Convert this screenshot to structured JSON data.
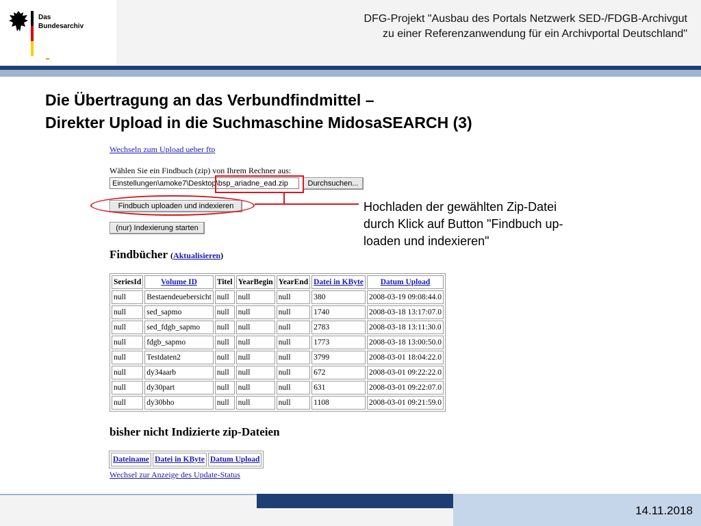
{
  "header": {
    "logo_line1": "Das",
    "logo_line2": "Bundesarchiv",
    "title_line1": "DFG-Projekt \"Ausbau des Portals Netzwerk SED-/FDGB-Archivgut",
    "title_line2": "zu einer Referenzanwendung für ein Archivportal Deutschland\""
  },
  "slide": {
    "title_line1": "Die Übertragung an das Verbundfindmittel –",
    "title_line2": "Direkter Upload in die Suchmaschine MidosaSEARCH (3)"
  },
  "app": {
    "ftp_link": "Wechseln zum Upload ueber ftp",
    "choose_label": "Wählen Sie ein Findbuch (zip) von Ihrem Rechner aus:",
    "file_value": "Einstellungen\\amoke7\\Desktop\\bsp_ariadne_ead.zip",
    "browse_button": "Durchsuchen...",
    "upload_button": "Findbuch uploaden und indexieren",
    "index_button": "(nur) Indexierung starten",
    "findbuecher_title": "Findbücher",
    "paren_open": "(",
    "refresh_link": "Aktualisieren",
    "paren_close": ")",
    "table_headers": [
      "SeriesId",
      "Volume ID",
      "Titel",
      "YearBegin",
      "YearEnd",
      "Datei in KByte",
      "Datum Upload"
    ],
    "rows": [
      [
        "null",
        "Bestaendeuebersicht",
        "null",
        "null",
        "null",
        "380",
        "2008-03-19 09:08:44.0"
      ],
      [
        "null",
        "sed_sapmo",
        "null",
        "null",
        "null",
        "1740",
        "2008-03-18 13:17:07.0"
      ],
      [
        "null",
        "sed_fdgb_sapmo",
        "null",
        "null",
        "null",
        "2783",
        "2008-03-18 13:11:30.0"
      ],
      [
        "null",
        "fdgb_sapmo",
        "null",
        "null",
        "null",
        "1773",
        "2008-03-18 13:00:50.0"
      ],
      [
        "null",
        "Testdaten2",
        "null",
        "null",
        "null",
        "3799",
        "2008-03-01 18:04:22.0"
      ],
      [
        "null",
        "dy34aarb",
        "null",
        "null",
        "null",
        "672",
        "2008-03-01 09:22:22.0"
      ],
      [
        "null",
        "dy30part",
        "null",
        "null",
        "null",
        "631",
        "2008-03-01 09:22:07.0"
      ],
      [
        "null",
        "dy30bho",
        "null",
        "null",
        "null",
        "1108",
        "2008-03-01 09:21:59.0"
      ]
    ],
    "unindexed_title": "bisher nicht Indizierte zip-Dateien",
    "unindexed_headers": [
      "Dateiname",
      "Datei in KByte",
      "Datum Upload"
    ],
    "status_link": "Wechsel zur Anzeige des Update-Status"
  },
  "callout": {
    "line1": "Hochladen der gewählten Zip-Datei",
    "line2": "durch Klick auf Button \"Findbuch up-",
    "line3": "loaden und indexieren\""
  },
  "footer": {
    "date": "14.11.2018"
  },
  "colors": {
    "accent_dark": "#1f3f74",
    "accent_light": "#9fb5cf",
    "highlight": "#d71920",
    "link": "#1a1ab0"
  },
  "icons": {
    "logo": "federal-eagle-icon"
  }
}
